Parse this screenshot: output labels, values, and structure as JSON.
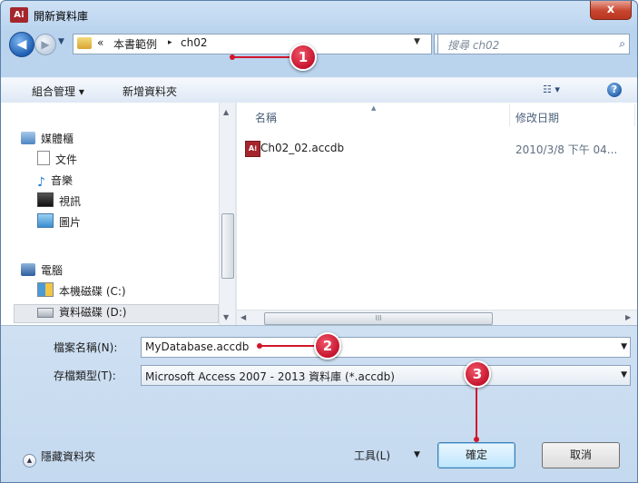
{
  "window": {
    "app_icon": "A⁞",
    "title": "開新資料庫",
    "close_label": "x"
  },
  "nav": {
    "back_icon": "back-arrow-icon",
    "crumbs": [
      "«",
      "本書範例",
      "▸",
      "ch02"
    ],
    "search_placeholder": "搜尋 ch02"
  },
  "toolbar": {
    "organize": "組合管理 ▾",
    "new_folder": "新增資料夾",
    "view": "☷ ▾",
    "help": "?"
  },
  "nav_pane": {
    "items": [
      {
        "label": "媒體櫃",
        "icon": "library-icon"
      },
      {
        "label": "文件",
        "icon": "document-icon"
      },
      {
        "label": "音樂",
        "icon": "music-icon"
      },
      {
        "label": "視訊",
        "icon": "video-icon"
      },
      {
        "label": "圖片",
        "icon": "picture-icon"
      },
      {
        "label": "電腦",
        "icon": "computer-icon"
      },
      {
        "label": "本機磁碟 (C:)",
        "icon": "system-drive-icon"
      },
      {
        "label": "資料磁碟 (D:)",
        "icon": "drive-icon"
      }
    ]
  },
  "file_list": {
    "columns": [
      "名稱",
      "修改日期"
    ],
    "rows": [
      {
        "name": "Ch02_02.accdb",
        "modified": "2010/3/8 下午 04...",
        "icon_text": "A⁞"
      }
    ],
    "hscroll_grip": "III"
  },
  "form": {
    "filename_label": "檔案名稱(N):",
    "filename_value": "MyDatabase.accdb",
    "filetype_label": "存檔類型(T):",
    "filetype_value": "Microsoft Access 2007 - 2013 資料庫 (*.accdb)",
    "hide_folders": "隱藏資料夾",
    "tools": "工具(L)",
    "ok": "確定",
    "cancel": "取消"
  },
  "callouts": [
    "1",
    "2",
    "3"
  ],
  "colors": {
    "callout": "#d2162b",
    "title_bar": "#c6dbf0",
    "access_red": "#a4262c"
  }
}
